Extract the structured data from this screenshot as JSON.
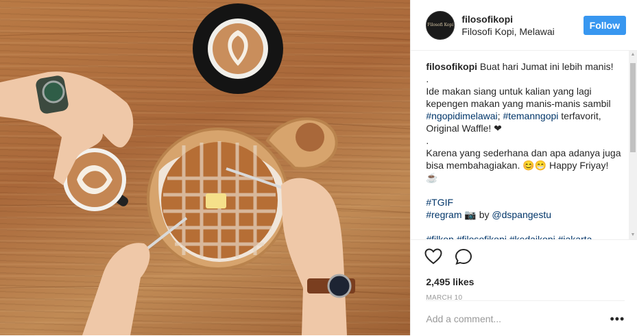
{
  "post": {
    "image_alt": "Overhead photo of a waffle with butter on a wooden board, two latte art coffees and two hands with watches on a wooden table"
  },
  "header": {
    "avatar_text": "Filosofi Kopi",
    "username": "filosofikopi",
    "location": "Filosofi Kopi, Melawai",
    "follow_label": "Follow"
  },
  "caption": {
    "username": "filosofikopi",
    "line1": " Buat hari Jumat ini lebih manis!",
    "dot1": ".",
    "line2a": "Ide makan siang untuk kalian yang lagi kepengen makan yang manis-manis sambil ",
    "tag1": "#ngopidimelawai",
    "line2b": "; ",
    "tag2": "#temanngopi",
    "line2c": " terfavorit, Original Waffle! ❤",
    "dot2": ".",
    "line3": "Karena yang sederhana dan apa adanya juga bisa membahagiakan. 😊😁 Happy Friyay! ☕",
    "tag3": "#TGIF",
    "tag4": "#regram",
    "regram_mid": " 📷 by ",
    "mention": "@dspangestu",
    "tags_last": "#filkop #filosofikopi #kedaikopi #jakarta"
  },
  "actions": {
    "like_icon": "heart-outline-icon",
    "comment_icon": "speech-bubble-icon",
    "likes": "2,495 likes",
    "date": "MARCH 10"
  },
  "comment": {
    "placeholder": "Add a comment...",
    "more_label": "•••"
  },
  "colors": {
    "accent": "#3897f0",
    "hashtag": "#003569",
    "border": "#efefef"
  }
}
